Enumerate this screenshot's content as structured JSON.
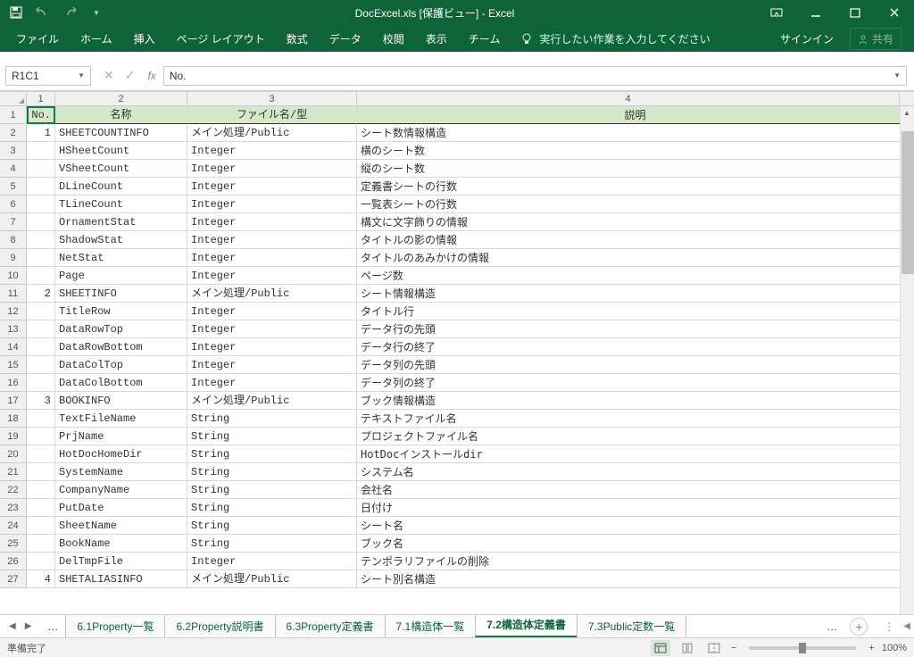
{
  "title": "DocExcel.xls  [保護ビュー] - Excel",
  "ribbon": {
    "tabs": [
      "ファイル",
      "ホーム",
      "挿入",
      "ページ レイアウト",
      "数式",
      "データ",
      "校閲",
      "表示",
      "チーム"
    ],
    "tellme": "実行したい作業を入力してください",
    "signin": "サインイン",
    "share": "共有"
  },
  "namebox": "R1C1",
  "formula": "No.",
  "headers": {
    "c1": "No.",
    "c2": "名称",
    "c3": "ファイル名/型",
    "c4": "説明"
  },
  "colnums": [
    "1",
    "2",
    "3",
    "4"
  ],
  "rows": [
    {
      "n": "1",
      "name": "SHEETCOUNTINFO",
      "type": "メイン処理/Public",
      "desc": "シート数情報構造"
    },
    {
      "n": "",
      "name": "HSheetCount",
      "type": "Integer",
      "desc": "横のシート数"
    },
    {
      "n": "",
      "name": "VSheetCount",
      "type": "Integer",
      "desc": "縦のシート数"
    },
    {
      "n": "",
      "name": "DLineCount",
      "type": "Integer",
      "desc": "定義書シートの行数"
    },
    {
      "n": "",
      "name": "TLineCount",
      "type": "Integer",
      "desc": "一覧表シートの行数"
    },
    {
      "n": "",
      "name": "OrnamentStat",
      "type": "Integer",
      "desc": "構文に文字飾りの情報"
    },
    {
      "n": "",
      "name": "ShadowStat",
      "type": "Integer",
      "desc": "タイトルの影の情報"
    },
    {
      "n": "",
      "name": "NetStat",
      "type": "Integer",
      "desc": "タイトルのあみかけの情報"
    },
    {
      "n": "",
      "name": "Page",
      "type": "Integer",
      "desc": "ページ数"
    },
    {
      "n": "2",
      "name": "SHEETINFO",
      "type": "メイン処理/Public",
      "desc": "シート情報構造"
    },
    {
      "n": "",
      "name": "TitleRow",
      "type": "Integer",
      "desc": "タイトル行"
    },
    {
      "n": "",
      "name": "DataRowTop",
      "type": "Integer",
      "desc": "データ行の先頭"
    },
    {
      "n": "",
      "name": "DataRowBottom",
      "type": "Integer",
      "desc": "データ行の終了"
    },
    {
      "n": "",
      "name": "DataColTop",
      "type": "Integer",
      "desc": "データ列の先頭"
    },
    {
      "n": "",
      "name": "DataColBottom",
      "type": "Integer",
      "desc": "データ列の終了"
    },
    {
      "n": "3",
      "name": "BOOKINFO",
      "type": "メイン処理/Public",
      "desc": "ブック情報構造"
    },
    {
      "n": "",
      "name": "TextFileName",
      "type": "String",
      "desc": "テキストファイル名"
    },
    {
      "n": "",
      "name": "PrjName",
      "type": "String",
      "desc": "プロジェクトファイル名"
    },
    {
      "n": "",
      "name": "HotDocHomeDir",
      "type": "String",
      "desc": "HotDocインストールdir"
    },
    {
      "n": "",
      "name": "SystemName",
      "type": "String",
      "desc": "システム名"
    },
    {
      "n": "",
      "name": "CompanyName",
      "type": "String",
      "desc": "会社名"
    },
    {
      "n": "",
      "name": "PutDate",
      "type": "String",
      "desc": "日付け"
    },
    {
      "n": "",
      "name": "SheetName",
      "type": "String",
      "desc": "シート名"
    },
    {
      "n": "",
      "name": "BookName",
      "type": "String",
      "desc": "ブック名"
    },
    {
      "n": "",
      "name": "DelTmpFile",
      "type": "Integer",
      "desc": "テンポラリファイルの削除"
    },
    {
      "n": "4",
      "name": "SHETALIASINFO",
      "type": "メイン処理/Public",
      "desc": "シート別名構造"
    }
  ],
  "sheets": [
    "6.1Property一覧",
    "6.2Property説明書",
    "6.3Property定義書",
    "7.1構造体一覧",
    "7.2構造体定義書",
    "7.3Public定数一覧"
  ],
  "activeSheet": 4,
  "status": "準備完了",
  "zoom": "100%"
}
